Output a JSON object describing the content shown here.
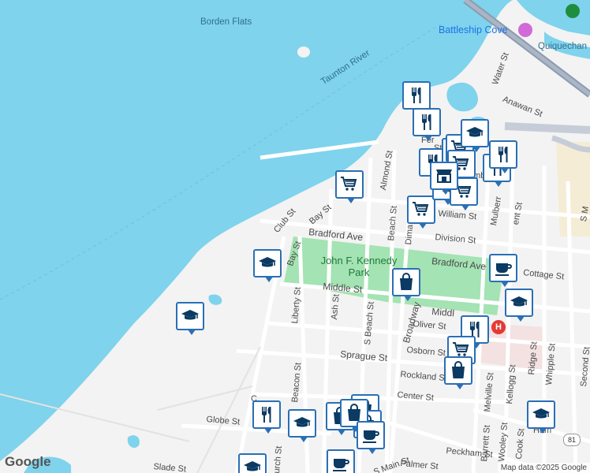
{
  "map": {
    "water_labels": {
      "borden_flats": "Borden Flats",
      "taunton_river": "Taunton River",
      "quiquechan_river": "Quiquechan River"
    },
    "poi": {
      "battleship_cove": "Battleship Cove",
      "park_name": "John F. Kennedy Park"
    },
    "streets": {
      "water_st": "Water St",
      "anawan_st": "Anawan St",
      "almond_st": "Almond St",
      "club_st": "Club St",
      "bay_st_1": "Bay St",
      "bay_st_2": "Bay St",
      "beach_st": "Beach St",
      "dimaio_st": "Dima",
      "william_st": "William St",
      "division_st": "Division St",
      "bradford_ave_1": "Bradford Ave",
      "bradford_ave_2": "Bradford Ave",
      "cottage_st": "Cottage St",
      "middle_st_1": "Middle St",
      "middle_st_2": "Middl",
      "liberty_st": "Liberty St",
      "ash_st": "Ash St",
      "s_beach_st": "S Beach St",
      "broadway": "Broadway",
      "oliver_st": "Oliver St",
      "osborn_st": "Osborn St",
      "sprague_st": "Sprague St",
      "rockland_st": "Rockland St",
      "center_st": "Center St",
      "beacon_st": "Beacon St",
      "globe_st": "Globe St",
      "slade_st": "Slade St",
      "peckham_st": "Peckham St",
      "palmer_st": "Palmer St",
      "s_main_st": "S Main St",
      "melville_st": "Melville St",
      "kellogg_st": "Kellogg St",
      "ridge_st": "Ridge St",
      "whipple_st": "Whipple St",
      "second_st": "Second St",
      "barrett_st": "Barrett St",
      "wooley_st": "Wooley St",
      "cook_st": "Cook St",
      "hamlet_st": "Ham",
      "church_st": "urch St",
      "mulberry_st": "Mulberr",
      "s_main_edge": "S M",
      "columbia_st": "umb",
      "ferry_st": "Fer",
      "st_fragment": "St",
      "lent_st": "ent St",
      "st_short": "St",
      "c_fragment": "C"
    },
    "route": "81",
    "hospital": "H",
    "logo": "Google",
    "attribution": "Map data ©2025 Google"
  },
  "markers": [
    {
      "type": "restaurant"
    },
    {
      "type": "restaurant"
    },
    {
      "type": "restaurant"
    },
    {
      "type": "restaurant"
    },
    {
      "type": "restaurant"
    },
    {
      "type": "restaurant"
    },
    {
      "type": "restaurant"
    },
    {
      "type": "restaurant"
    },
    {
      "type": "shopping-cart"
    },
    {
      "type": "shopping-cart"
    },
    {
      "type": "shopping-cart"
    },
    {
      "type": "shopping-cart"
    },
    {
      "type": "shopping-cart"
    },
    {
      "type": "shopping-cart"
    },
    {
      "type": "shopping-cart"
    },
    {
      "type": "school"
    },
    {
      "type": "school"
    },
    {
      "type": "school"
    },
    {
      "type": "school"
    },
    {
      "type": "school"
    },
    {
      "type": "school"
    },
    {
      "type": "school"
    },
    {
      "type": "shopping-bag"
    },
    {
      "type": "shopping-bag"
    },
    {
      "type": "shopping-bag"
    },
    {
      "type": "shopping-bag"
    },
    {
      "type": "shopping-bag"
    },
    {
      "type": "shopping-bag"
    },
    {
      "type": "cafe"
    },
    {
      "type": "cafe"
    },
    {
      "type": "cafe"
    },
    {
      "type": "store"
    }
  ],
  "colors": {
    "water": "#7fd3ec",
    "land": "#f3f3f3",
    "park": "#a4e3b3",
    "road": "#ffffff",
    "highway": "#8c9bb0",
    "marker_border": "#2a6fb5",
    "marker_icon": "#0b3a63"
  }
}
